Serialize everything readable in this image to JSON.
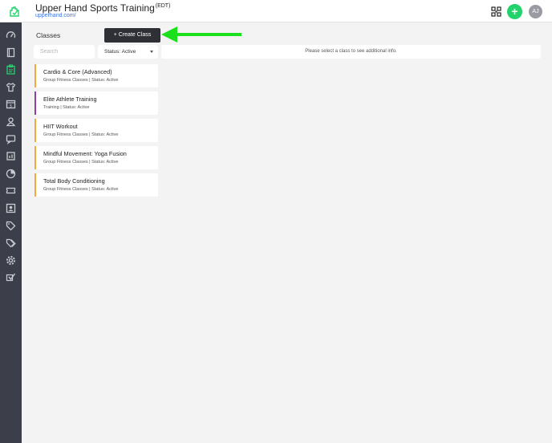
{
  "header": {
    "title": "Upper Hand Sports Training",
    "timezone": "(EDT)",
    "url": "upperhand.com/",
    "add_icon": "plus-icon",
    "add_symbol": "+",
    "qr_icon": "qr-scan-icon",
    "avatar_initials": "AJ"
  },
  "colors": {
    "accent": "#22d26b",
    "sidebar": "#3c3f4a",
    "arrow": "#1be01b"
  },
  "sidebar": {
    "items": [
      {
        "name": "dashboard-icon"
      },
      {
        "name": "book-icon"
      },
      {
        "name": "clipboard-icon",
        "active": true
      },
      {
        "name": "shirt-icon"
      },
      {
        "name": "calendar-icon"
      },
      {
        "name": "users-icon"
      },
      {
        "name": "chat-icon"
      },
      {
        "name": "report-icon"
      },
      {
        "name": "chart-icon"
      },
      {
        "name": "ticket-icon"
      },
      {
        "name": "contacts-icon"
      },
      {
        "name": "tag-icon"
      },
      {
        "name": "tags-icon"
      },
      {
        "name": "gear-icon"
      },
      {
        "name": "check-icon"
      }
    ]
  },
  "page": {
    "heading": "Classes",
    "create_button": "+ Create Class",
    "search_placeholder": "Search",
    "status_filter": "Status: Active",
    "info_message": "Please select a class to see additional info."
  },
  "classes": [
    {
      "name": "Cardio & Core (Advanced)",
      "meta": "Group Fitness Classes | Status: Active",
      "color": "#f2a93b"
    },
    {
      "name": "Elite Athlete Training",
      "meta": "Training | Status: Active",
      "color": "#8e3fa8"
    },
    {
      "name": "HIIT Workout",
      "meta": "Group Fitness Classes | Status: Active",
      "color": "#f2a93b"
    },
    {
      "name": "Mindful Movement: Yoga Fusion",
      "meta": "Group Fitness Classes | Status: Active",
      "color": "#f2a93b"
    },
    {
      "name": "Total Body Conditioning",
      "meta": "Group Fitness Classes | Status: Active",
      "color": "#f2a93b"
    }
  ]
}
